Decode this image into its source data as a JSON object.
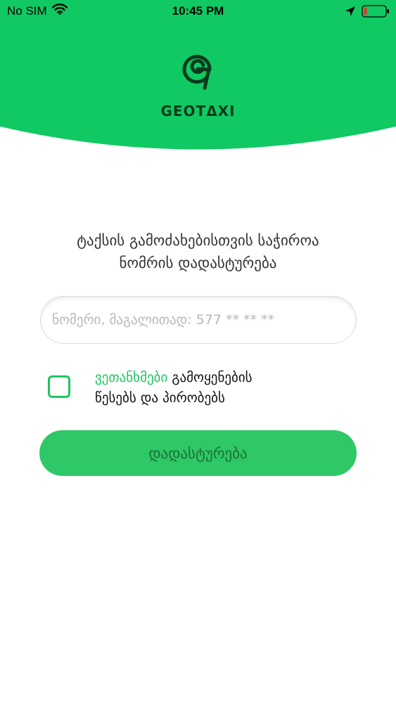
{
  "status_bar": {
    "carrier": "No SIM",
    "time": "10:45 PM"
  },
  "brand": {
    "name": "GEOTΔXI"
  },
  "prompt": {
    "line1": "ტაქსის გამოძახებისთვის საჭიროა",
    "line2": "ნომრის დადასტურება"
  },
  "phone": {
    "placeholder": "ნომერი, მაგალითად: 577 ** ** **",
    "value": ""
  },
  "terms": {
    "agree": "ვეთანხმები",
    "rest_line1": "გამოყენების",
    "rest_line2": "წესებს და პირობებს"
  },
  "confirm": {
    "label": "დადასტურება"
  },
  "colors": {
    "brand_green": "#10c963",
    "button_green": "#2ec866",
    "button_text": "#1c6f36",
    "checkbox_border": "#1fc561",
    "logo_dark": "#0a3a1c"
  },
  "icons": {
    "wifi": "wifi-icon",
    "location": "location-arrow-icon",
    "battery": "battery-low-icon",
    "logo": "geotaxi-logo-icon"
  }
}
